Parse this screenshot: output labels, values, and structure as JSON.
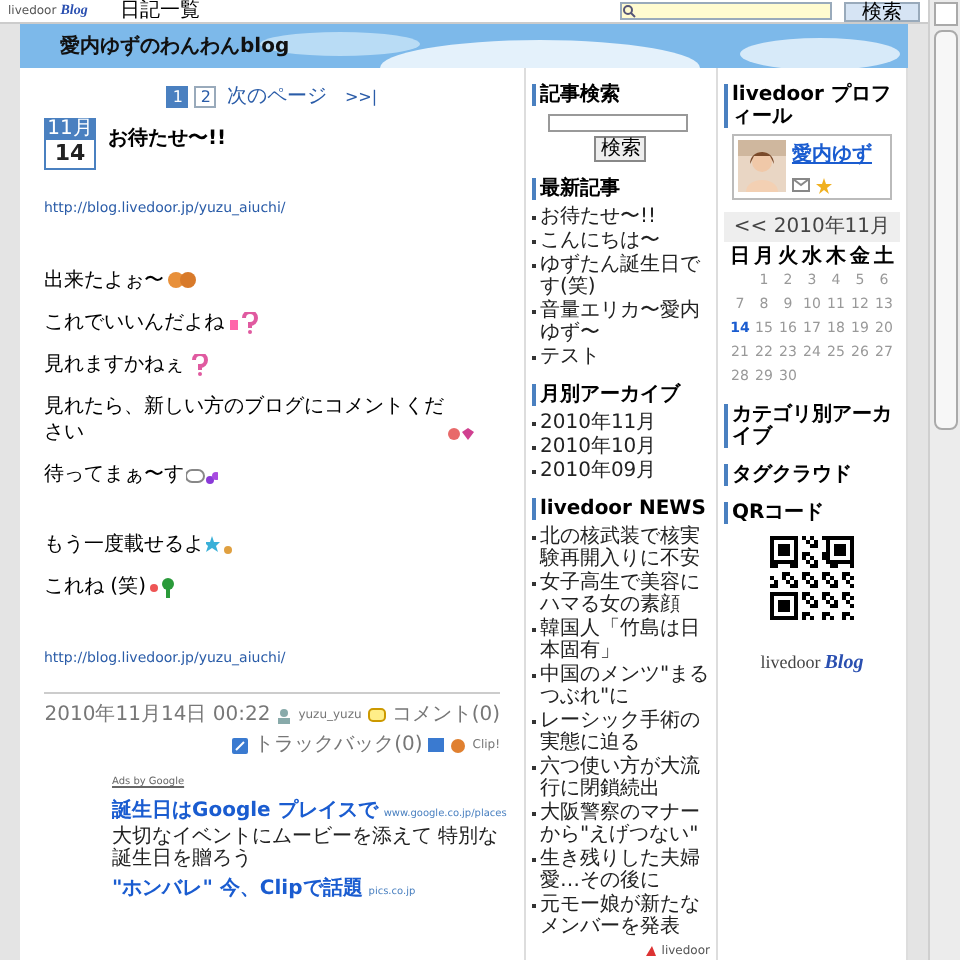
{
  "toolbar": {
    "logo_word": "livedoor",
    "logo_script": "Blog",
    "menu_link": "日記一覧",
    "search_button": "検索"
  },
  "blog_title": "愛内ゆずのわんわんblog",
  "pagination": {
    "pages": [
      {
        "label": "1",
        "selected": true
      },
      {
        "label": "2",
        "selected": false
      }
    ],
    "next": "次のページ",
    "last": ">>|"
  },
  "post": {
    "month": "11月",
    "day": "14",
    "title": "お待たせ〜!!",
    "body": [
      {
        "kind": "link",
        "text": "http://blog.livedoor.jp/yuzu_aiuchi/"
      },
      {
        "kind": "gap"
      },
      {
        "kind": "text",
        "text": "出来たよぉ〜"
      },
      {
        "kind": "text",
        "text": "これでいいんだよね"
      },
      {
        "kind": "text",
        "text": "見れますかねぇ"
      },
      {
        "kind": "text",
        "text": "見れたら、新しい方のブログにコメントください"
      },
      {
        "kind": "text",
        "text": "待ってまぁ〜す"
      },
      {
        "kind": "gap"
      },
      {
        "kind": "text",
        "text": "もう一度載せるよ"
      },
      {
        "kind": "text",
        "text": "これね (笑)"
      },
      {
        "kind": "gap"
      },
      {
        "kind": "link",
        "text": "http://blog.livedoor.jp/yuzu_aiuchi/"
      }
    ],
    "meta": {
      "datetime": "2010年11月14日 00:22",
      "author": "yuzu_yuzu",
      "comments": "コメント(0)",
      "trackback": "トラックバック(0)",
      "clip": "Clip!"
    }
  },
  "ads": {
    "label": "Ads by Google",
    "items": [
      {
        "title": "誕生日はGoogle プレイスで",
        "url": "www.google.co.jp/places",
        "desc": "大切なイベントにムービーを添えて 特別な誕生日を贈ろう"
      },
      {
        "title": "\"ホンバレ\" 今、Clipで話題",
        "url": "pics.co.jp"
      }
    ]
  },
  "sidebar_left": [
    {
      "kind": "search",
      "title": "記事検索",
      "button": "検索"
    },
    {
      "kind": "list",
      "title": "最新記事",
      "items": [
        "お待たせ〜!!",
        "こんにちは〜",
        "ゆずたん誕生日です(笑)",
        "音量エリカ〜愛内ゆず〜",
        "テスト"
      ]
    },
    {
      "kind": "list",
      "title": "月別アーカイブ",
      "items": [
        "2010年11月",
        "2010年10月",
        "2010年09月"
      ]
    },
    {
      "kind": "news",
      "title": "livedoor NEWS",
      "items": [
        "北の核武装で核実験再開入りに不安",
        "女子高生で美容にハマる女の素顔",
        "韓国人「竹島は日本固有」",
        "中国のメンツ\"まるつぶれ\"に",
        "レーシック手術の実態に迫る",
        "六つ使い方が大流行に閉鎖続出",
        "大阪警察のマナーから\"えげつない\"",
        "生き残りした夫婦愛…その後に",
        "元モー娘が新たなメンバーを発表"
      ],
      "source": "livedoor"
    }
  ],
  "sidebar_right": [
    {
      "kind": "profile",
      "title": "livedoor プロフィール",
      "name": "愛内ゆず"
    },
    {
      "kind": "calendar",
      "title": "<< 2010年11月",
      "weekdays": [
        "日",
        "月",
        "火",
        "水",
        "木",
        "金",
        "土"
      ],
      "weeks": [
        [
          {
            "d": "1",
            "selected": false
          },
          {
            "d": "2",
            "selected": false
          },
          {
            "d": "3",
            "selected": false
          },
          {
            "d": "4",
            "selected": false
          },
          {
            "d": "5",
            "selected": false
          },
          {
            "d": "6",
            "selected": false
          }
        ],
        [
          {
            "d": "7",
            "selected": false
          },
          {
            "d": "8",
            "selected": false
          },
          {
            "d": "9",
            "selected": false
          },
          {
            "d": "10",
            "selected": false
          },
          {
            "d": "11",
            "selected": false
          },
          {
            "d": "12",
            "selected": false
          },
          {
            "d": "13",
            "selected": false
          }
        ],
        [
          {
            "d": "14",
            "selected": true
          },
          {
            "d": "15",
            "selected": false
          },
          {
            "d": "16",
            "selected": false
          },
          {
            "d": "17",
            "selected": false
          },
          {
            "d": "18",
            "selected": false
          },
          {
            "d": "19",
            "selected": false
          },
          {
            "d": "20",
            "selected": false
          }
        ],
        [
          {
            "d": "21",
            "selected": false
          },
          {
            "d": "22",
            "selected": false
          },
          {
            "d": "23",
            "selected": false
          },
          {
            "d": "24",
            "selected": false
          },
          {
            "d": "25",
            "selected": false
          },
          {
            "d": "26",
            "selected": false
          },
          {
            "d": "27",
            "selected": false
          }
        ],
        [
          {
            "d": "28",
            "selected": false
          },
          {
            "d": "29",
            "selected": false
          },
          {
            "d": "30",
            "selected": false
          }
        ]
      ]
    },
    {
      "kind": "heading",
      "title": "カテゴリ別アーカイブ"
    },
    {
      "kind": "heading",
      "title": "タグクラウド"
    },
    {
      "kind": "qr",
      "title": "QRコード",
      "logo_word": "livedoor",
      "logo_script": "Blog"
    }
  ]
}
